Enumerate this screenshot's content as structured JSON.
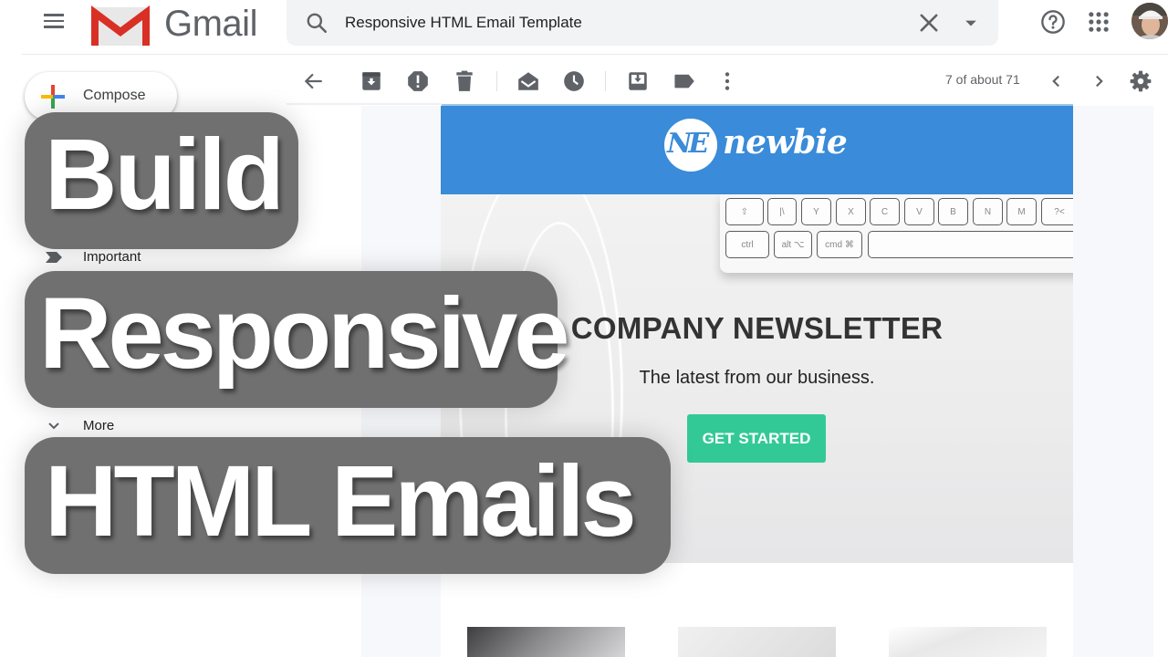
{
  "app": {
    "name": "Gmail",
    "brand_colors": {
      "red": "#EA4335",
      "blue": "#4285F4",
      "yellow": "#FBBC04",
      "green": "#34A853"
    }
  },
  "header": {
    "menu_icon": "hamburger-menu-icon",
    "logo_label": "Gmail",
    "search": {
      "value": "Responsive HTML Email Template",
      "placeholder": "Search mail",
      "search_icon": "search-icon",
      "clear_icon": "close-icon",
      "options_icon": "caret-down-icon"
    },
    "help_icon": "help-icon",
    "apps_icon": "apps-grid-icon",
    "avatar_icon": "user-avatar"
  },
  "sidebar": {
    "compose_label": "Compose",
    "items": [
      {
        "label": "Important",
        "icon": "important-marker-icon"
      },
      {
        "label": "More",
        "icon": "chevron-down-icon"
      }
    ]
  },
  "toolbar": {
    "buttons": [
      {
        "name": "back",
        "icon": "arrow-left-icon"
      },
      {
        "name": "archive",
        "icon": "archive-icon"
      },
      {
        "name": "report-spam",
        "icon": "report-spam-icon"
      },
      {
        "name": "delete",
        "icon": "trash-icon"
      },
      {
        "name": "mark-unread",
        "icon": "mark-unread-icon"
      },
      {
        "name": "snooze",
        "icon": "clock-icon"
      },
      {
        "name": "move-to",
        "icon": "move-to-inbox-icon"
      },
      {
        "name": "labels",
        "icon": "label-icon"
      },
      {
        "name": "more",
        "icon": "more-vert-icon"
      }
    ],
    "pager_text": "7 of about 71",
    "prev_icon": "chevron-left-icon",
    "next_icon": "chevron-right-icon",
    "settings_icon": "gear-icon"
  },
  "email": {
    "brand_mark": "NE",
    "brand_name": "newbie",
    "header_color": "#3A8BD9",
    "hero_title": "COMPANY NEWSLETTER",
    "hero_subtitle": "The latest from our business.",
    "cta_label": "GET STARTED",
    "cta_color": "#33C997",
    "keyboard_keys_row1": [
      "⇧",
      "|\\",
      "Y",
      "X",
      "C",
      "V",
      "B",
      "N",
      "M",
      "?<"
    ],
    "keyboard_keys_row2": [
      "ctrl",
      "alt ⌥",
      "cmd ⌘",
      ""
    ]
  },
  "overlay": {
    "line1": "Build",
    "line2": "Responsive",
    "line3": "HTML Emails"
  }
}
